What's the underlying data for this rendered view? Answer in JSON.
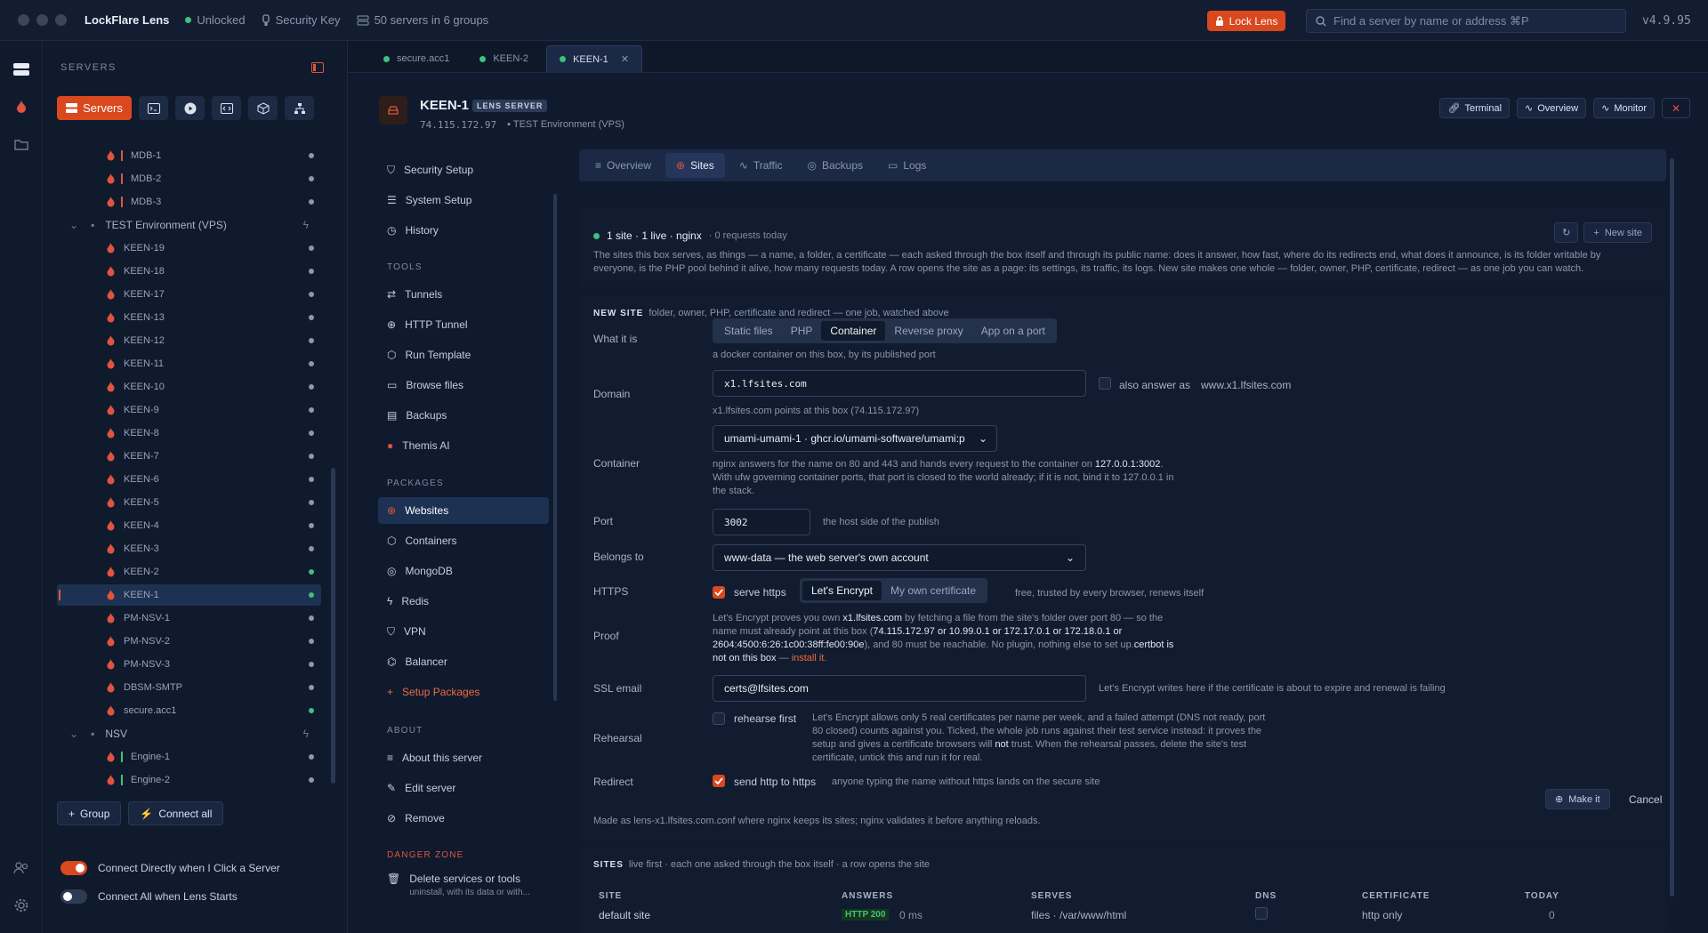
{
  "app": {
    "name": "LockFlare Lens",
    "status": "Unlocked",
    "key_label": "Security Key",
    "servers_summary": "50 servers in 6 groups",
    "lock_button": "Lock Lens",
    "search_placeholder": "Find a server by name or address  ⌘P",
    "version": "v4.9.95"
  },
  "sidebar": {
    "title": "SERVERS",
    "servers_button": "Servers",
    "rows": [
      {
        "label": "MDB-1",
        "type": "server",
        "bar": "#e0543e",
        "online": false
      },
      {
        "label": "MDB-2",
        "type": "server",
        "bar": "#e0543e",
        "online": false
      },
      {
        "label": "MDB-3",
        "type": "server",
        "bar": "#e0543e",
        "online": false
      },
      {
        "label": "TEST Environment (VPS)",
        "type": "group"
      },
      {
        "label": "KEEN-19",
        "type": "server",
        "online": false
      },
      {
        "label": "KEEN-18",
        "type": "server",
        "online": false
      },
      {
        "label": "KEEN-17",
        "type": "server",
        "online": false
      },
      {
        "label": "KEEN-13",
        "type": "server",
        "online": false
      },
      {
        "label": "KEEN-12",
        "type": "server",
        "online": false
      },
      {
        "label": "KEEN-11",
        "type": "server",
        "online": false
      },
      {
        "label": "KEEN-10",
        "type": "server",
        "online": false
      },
      {
        "label": "KEEN-9",
        "type": "server",
        "online": false
      },
      {
        "label": "KEEN-8",
        "type": "server",
        "online": false
      },
      {
        "label": "KEEN-7",
        "type": "server",
        "online": false
      },
      {
        "label": "KEEN-6",
        "type": "server",
        "online": false
      },
      {
        "label": "KEEN-5",
        "type": "server",
        "online": false
      },
      {
        "label": "KEEN-4",
        "type": "server",
        "online": false
      },
      {
        "label": "KEEN-3",
        "type": "server",
        "online": false
      },
      {
        "label": "KEEN-2",
        "type": "server",
        "online": true
      },
      {
        "label": "KEEN-1",
        "type": "server",
        "online": true,
        "selected": true
      },
      {
        "label": "PM-NSV-1",
        "type": "server",
        "online": false
      },
      {
        "label": "PM-NSV-2",
        "type": "server",
        "online": false
      },
      {
        "label": "PM-NSV-3",
        "type": "server",
        "online": false
      },
      {
        "label": "DBSM-SMTP",
        "type": "server",
        "online": false
      },
      {
        "label": "secure.acc1",
        "type": "server",
        "online": true
      },
      {
        "label": "NSV",
        "type": "group"
      },
      {
        "label": "Engine-1",
        "type": "server",
        "bar": "#3ec27a",
        "online": false
      },
      {
        "label": "Engine-2",
        "type": "server",
        "bar": "#3ec27a",
        "online": false
      }
    ],
    "group_button": "Group",
    "connect_all_button": "Connect all",
    "toggle_connect_direct": "Connect Directly when I Click a Server",
    "toggle_connect_all": "Connect All when Lens Starts"
  },
  "tabs": [
    {
      "label": "secure.acc1"
    },
    {
      "label": "KEEN-2"
    },
    {
      "label": "KEEN-1",
      "active": true
    }
  ],
  "header": {
    "title": "KEEN-1",
    "badge": "LENS SERVER",
    "ip": "74.115.172.97",
    "env": "TEST Environment (VPS)",
    "terminal": "Terminal",
    "overview": "Overview",
    "monitor": "Monitor"
  },
  "nav": {
    "items_top": [
      "Security Setup",
      "System Setup",
      "History"
    ],
    "tools_title": "TOOLS",
    "tools": [
      "Tunnels",
      "HTTP Tunnel",
      "Run Template",
      "Browse files",
      "Backups",
      "Themis AI"
    ],
    "packages_title": "PACKAGES",
    "packages": [
      "Websites",
      "Containers",
      "MongoDB",
      "Redis",
      "VPN",
      "Balancer",
      "Setup Packages"
    ],
    "about_title": "ABOUT",
    "about": [
      "About this server",
      "Edit server",
      "Remove"
    ],
    "danger_title": "DANGER ZONE",
    "danger_item": "Delete services or tools",
    "danger_sub": "uninstall, with its data or with..."
  },
  "subtabs": [
    "Overview",
    "Sites",
    "Traffic",
    "Backups",
    "Logs"
  ],
  "sites": {
    "status": "1 site · 1 live · nginx",
    "requests": "· 0 requests today",
    "refresh_label": "",
    "new_site": "New site",
    "description": "The sites this box serves, as things — a name, a folder, a certificate — each asked through the box itself and through its public name: does it answer, how fast, where do its redirects end, what does it announce, is its folder writable by everyone, is the PHP pool behind it alive, how many requests today. A row opens the site as a page: its settings, its traffic, its logs. New site makes one whole — folder, owner, PHP, certificate, redirect — as one job you can watch."
  },
  "form": {
    "title": "NEW SITE",
    "subtitle": "folder, owner, PHP, certificate and redirect — one job, watched above",
    "what_label": "What it is",
    "kinds": [
      "Static files",
      "PHP",
      "Container",
      "Reverse proxy",
      "App on a port"
    ],
    "kind_hint": "a docker container on this box, by its published port",
    "domain_label": "Domain",
    "domain_value": "x1.lfsites.com",
    "also_label": "also answer as",
    "also_value": "www.x1.lfsites.com",
    "domain_hint": "x1.lfsites.com points at this box (74.115.172.97)",
    "container_label": "Container",
    "container_value": "umami-umami-1 · ghcr.io/umami-software/umami:p",
    "container_hint_1": "nginx answers for the name on 80 and 443 and hands every request to the container on",
    "container_hint_addr": "127.0.0.1:3002",
    "container_hint_2": "With ufw governing container ports, that port is closed to the world already; if it is not, bind it to 127.0.0.1 in the stack.",
    "port_label": "Port",
    "port_value": "3002",
    "port_hint": "the host side of the publish",
    "belongs_label": "Belongs to",
    "belongs_value": "www-data — the web server's own account",
    "https_label": "HTTPS",
    "serve_https": "serve https",
    "cert_options": [
      "Let's Encrypt",
      "My own certificate"
    ],
    "cert_hint": "free, trusted by every browser, renews itself",
    "proof_label": "Proof",
    "proof_1": "Let's Encrypt proves you own",
    "proof_domain": "x1.lfsites.com",
    "proof_2": "by fetching a file from the site's folder over port 80 — so the name must already point at this box (",
    "proof_ips": "74.115.172.97 or 10.99.0.1 or 172.17.0.1 or 172.18.0.1 or 2604:4500:6:26:1c00:38ff:fe00:90e",
    "proof_3": "), and 80 must be reachable. No plugin, nothing else to set up.",
    "proof_certbot": "certbot is not on this box",
    "proof_dash": " — ",
    "proof_install": "install it.",
    "ssl_label": "SSL email",
    "ssl_value": "certs@lfsites.com",
    "ssl_hint": "Let's Encrypt writes here if the certificate is about to expire and renewal is failing",
    "rehearsal_label": "Rehearsal",
    "rehearse_first": "rehearse first",
    "rehearsal_hint_1": "Let's Encrypt allows only 5 real certificates per name per week, and a failed attempt (DNS not ready, port 80 closed) counts against you. Ticked, the whole job runs against their test service instead: it proves the setup and gives a certificate browsers will",
    "rehearsal_not": "not",
    "rehearsal_hint_2": "trust. When the rehearsal passes, delete the site's test certificate, untick this and run it for real.",
    "redirect_label": "Redirect",
    "redirect_check": "send http to https",
    "redirect_hint": "anyone typing the name without https lands on the secure site",
    "make_it": "Make it",
    "cancel": "Cancel",
    "footer": "Made as lens-x1.lfsites.com.conf where nginx keeps its sites; nginx validates it before anything reloads."
  },
  "table": {
    "title": "SITES",
    "subtitle": "live first · each one asked through the box itself · a row opens the site",
    "columns": [
      "SITE",
      "ANSWERS",
      "SERVES",
      "DNS",
      "CERTIFICATE",
      "TODAY"
    ],
    "row": {
      "site": "default site",
      "answers": "HTTP 200",
      "ms": "0 ms",
      "serves": "files · /var/www/html",
      "certificate": "http only",
      "today": "0"
    }
  },
  "colors": {
    "accent": "#d9481f",
    "online": "#3ec27a",
    "bg": "#0f1a2e"
  }
}
